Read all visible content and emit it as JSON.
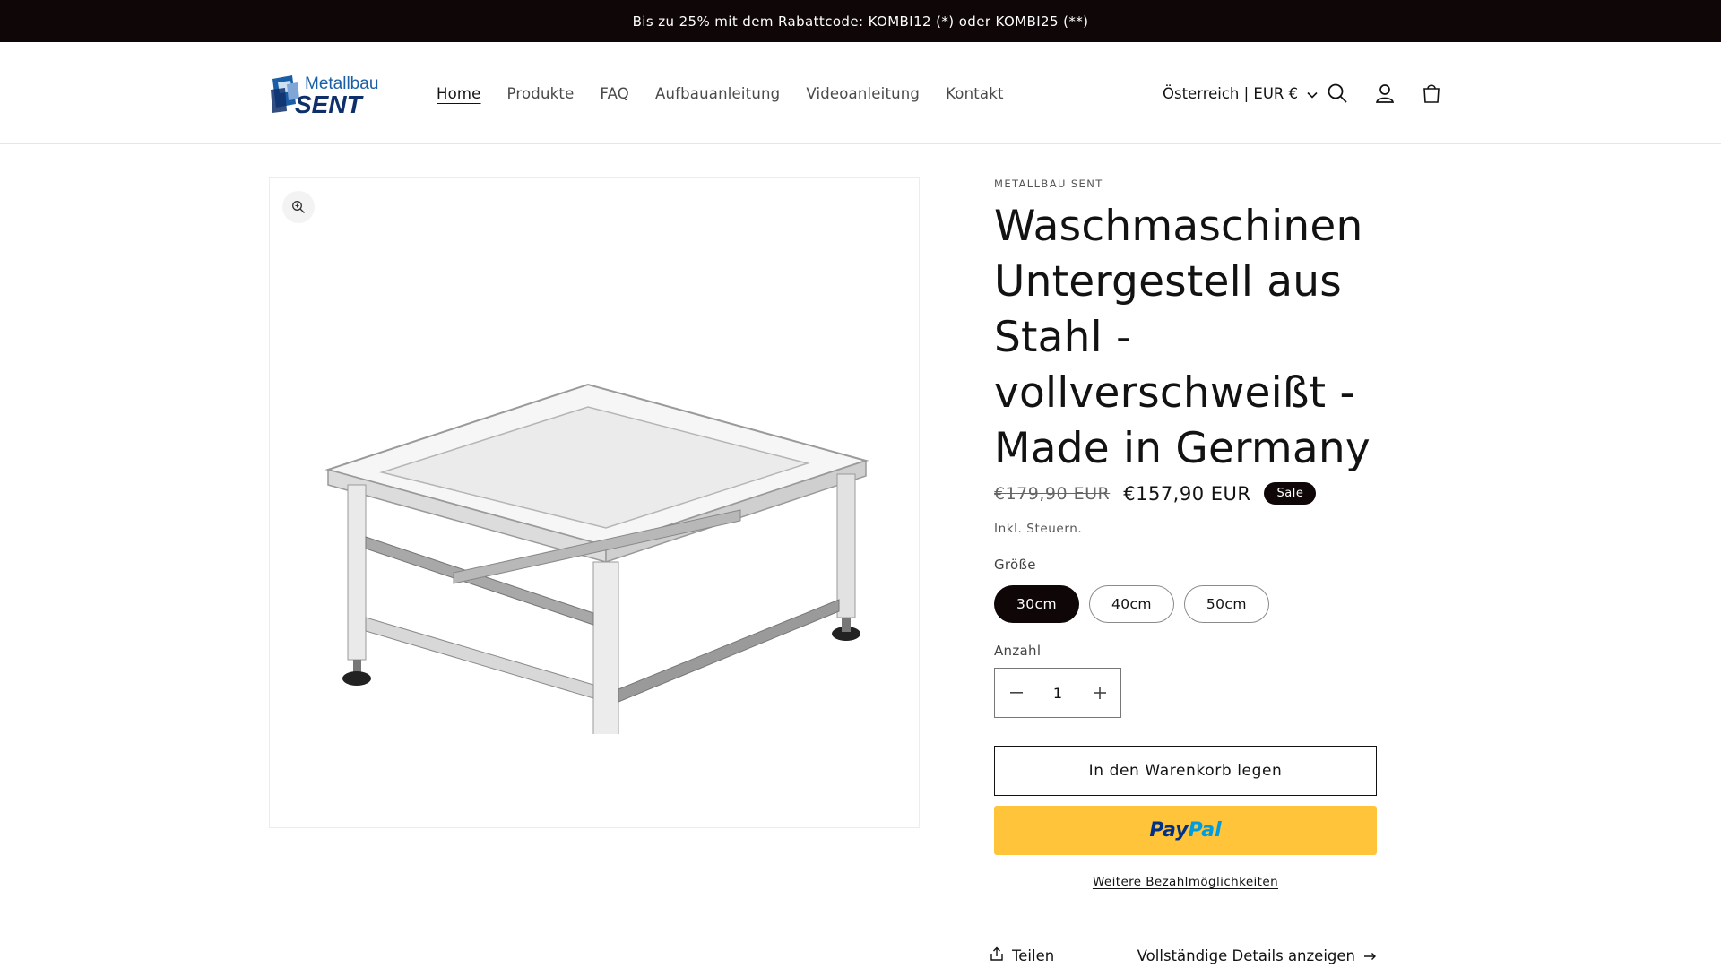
{
  "announcement": "Bis zu 25% mit dem Rabattcode: KOMBI12 (*) oder KOMBI25 (**)",
  "brand": {
    "line1": "Metallbau",
    "line2": "SENT",
    "color_blue": "#1a5fa6",
    "color_navy": "#0f2f6b"
  },
  "nav": [
    {
      "label": "Home",
      "active": true
    },
    {
      "label": "Produkte",
      "active": false
    },
    {
      "label": "FAQ",
      "active": false
    },
    {
      "label": "Aufbauanleitung",
      "active": false
    },
    {
      "label": "Videoanleitung",
      "active": false
    },
    {
      "label": "Kontakt",
      "active": false
    }
  ],
  "country_selector": "Österreich | EUR €",
  "header_icons": [
    "search-icon",
    "account-icon",
    "cart-icon"
  ],
  "product": {
    "vendor": "METALLBAU SENT",
    "title": "Waschmaschinen Untergestell aus Stahl - vollverschweißt - Made in Germany",
    "price_regular": "€179,90 EUR",
    "price_sale": "€157,90 EUR",
    "sale_badge": "Sale",
    "tax_note": "Inkl. Steuern.",
    "size_label": "Größe",
    "sizes": [
      {
        "label": "30cm",
        "selected": true
      },
      {
        "label": "40cm",
        "selected": false
      },
      {
        "label": "50cm",
        "selected": false
      }
    ],
    "quantity_label": "Anzahl",
    "quantity_value": "1",
    "add_to_cart": "In den Warenkorb legen",
    "paypal_label": "PayPal",
    "more_payment": "Weitere Bezahlmöglichkeiten",
    "share": "Teilen",
    "full_details": "Vollständige Details anzeigen"
  },
  "colors": {
    "announcement_bg": "#0f0707",
    "paypal_yellow": "#ffc439",
    "paypal_dark": "#003087",
    "paypal_light": "#009cde"
  }
}
